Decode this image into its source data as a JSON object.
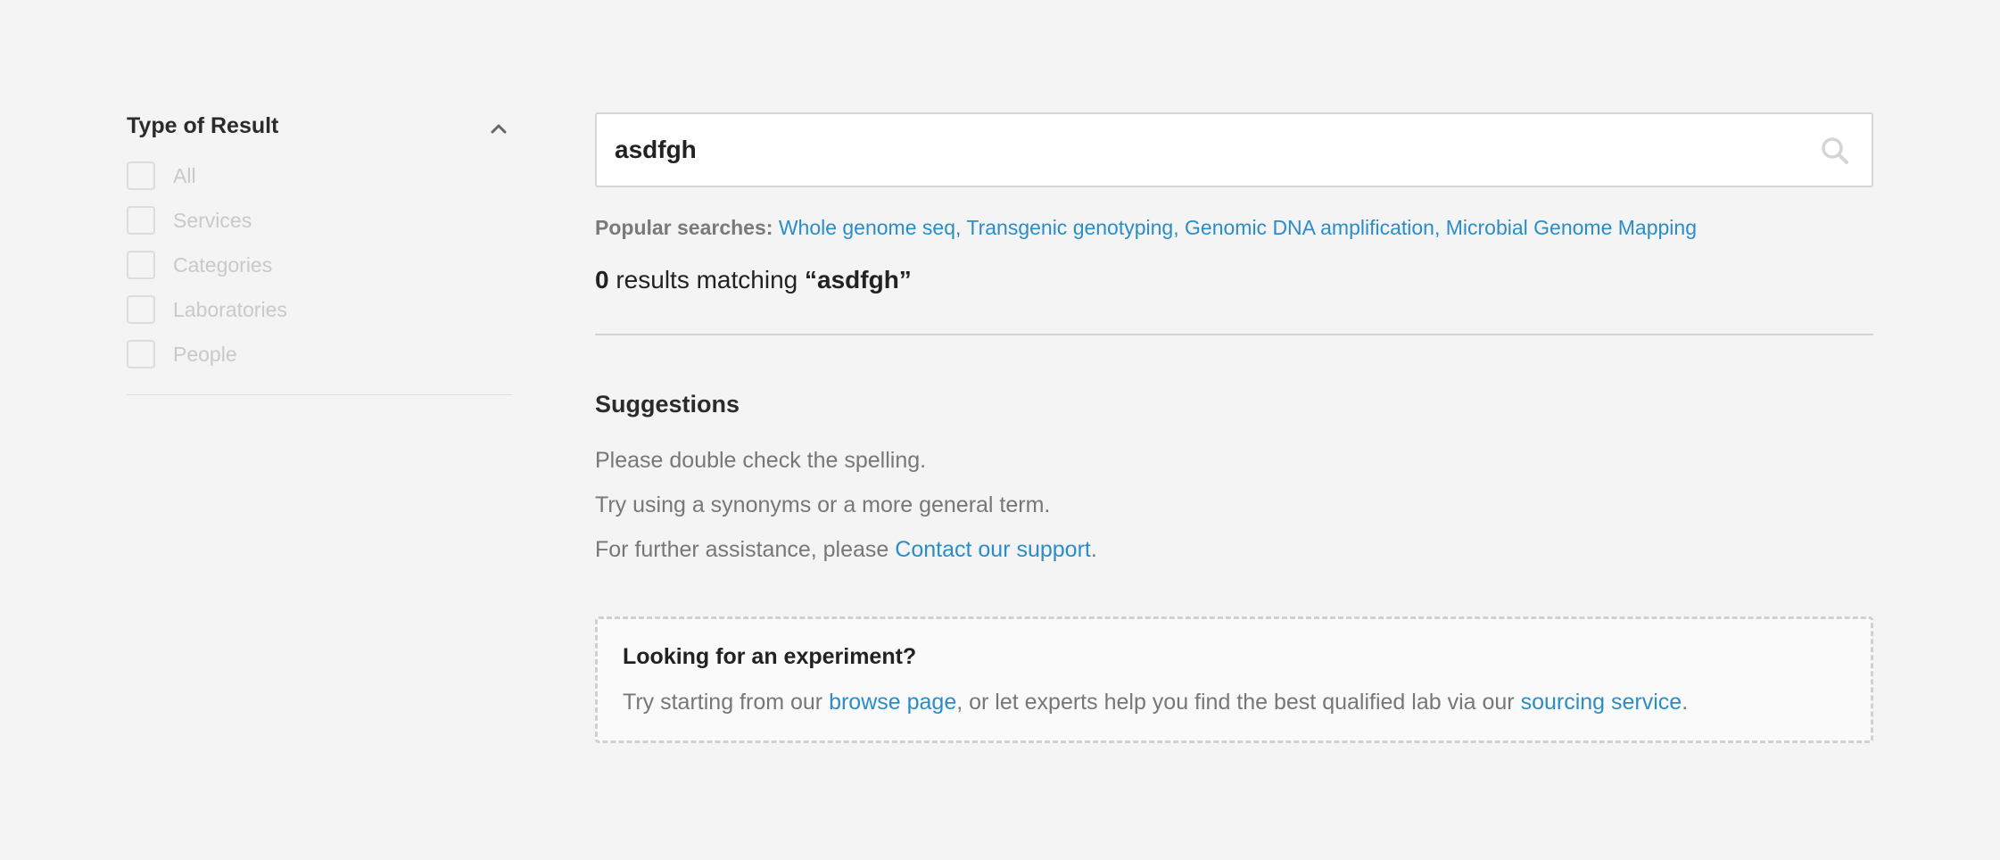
{
  "sidebar": {
    "title": "Type of Result",
    "items": [
      {
        "label": "All"
      },
      {
        "label": "Services"
      },
      {
        "label": "Categories"
      },
      {
        "label": "Laboratories"
      },
      {
        "label": "People"
      }
    ]
  },
  "search": {
    "value": "asdfgh",
    "icon": "search-icon"
  },
  "popular": {
    "label": "Popular searches:",
    "links": [
      "Whole genome seq",
      "Transgenic genotyping",
      "Genomic DNA amplification",
      "Microbial Genome Mapping"
    ],
    "separator": ","
  },
  "results": {
    "count": "0",
    "text": "results matching",
    "query": "“asdfgh”"
  },
  "suggestions": {
    "title": "Suggestions",
    "line1": "Please double check the spelling.",
    "line2": "Try using a synonyms or a more general term.",
    "line3_prefix": "For further assistance, please",
    "line3_link": "Contact our support",
    "line3_suffix": "."
  },
  "experiment": {
    "title": "Looking for an experiment?",
    "prefix": "Try starting from our",
    "link1": "browse page",
    "middle": ", or let experts help you find the best qualified lab via our",
    "link2": "sourcing service",
    "suffix": "."
  },
  "colors": {
    "background": "#f4f4f4",
    "link": "#2b8dc8",
    "muted_text": "#777777",
    "disabled_text": "#c9c9c9"
  }
}
